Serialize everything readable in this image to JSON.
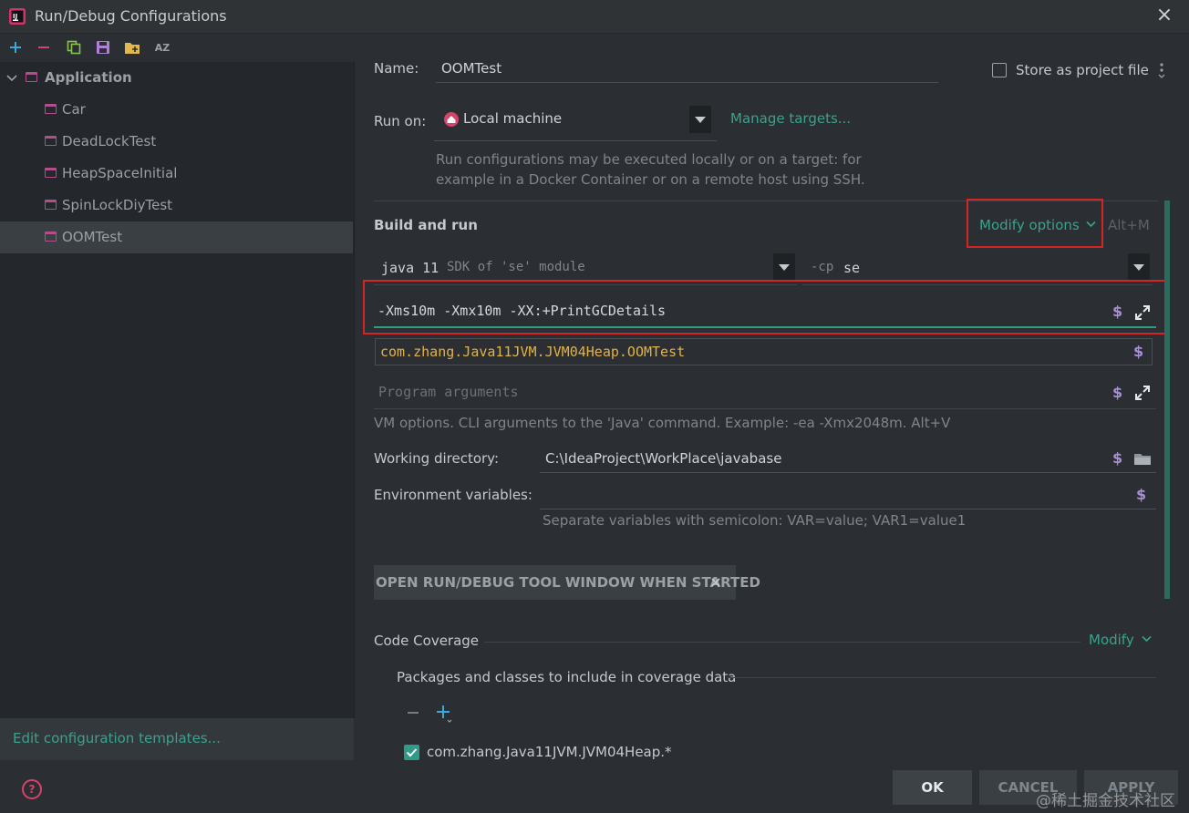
{
  "window": {
    "title": "Run/Debug Configurations",
    "close": "×"
  },
  "toolbar": {
    "sort_label": "AZ"
  },
  "tree": {
    "group": "Application",
    "items": [
      {
        "label": "Car",
        "selected": false
      },
      {
        "label": "DeadLockTest",
        "selected": false
      },
      {
        "label": "HeapSpaceInitial",
        "selected": false
      },
      {
        "label": "SpinLockDiyTest",
        "selected": false
      },
      {
        "label": "OOMTest",
        "selected": true
      }
    ]
  },
  "edit_templates": "Edit configuration templates...",
  "help": "?",
  "form": {
    "name_label": "Name:",
    "name_value": "OOMTest",
    "store_label": "Store as project file",
    "run_on_label": "Run on:",
    "run_on_value": "Local machine",
    "manage_targets": "Manage targets...",
    "run_hint_1": "Run configurations may be executed locally or on a target: for",
    "run_hint_2": "example in a Docker Container or on a remote host using SSH.",
    "build_run": "Build and run",
    "modify_options": "Modify options",
    "modify_shortcut": "Alt+M",
    "jdk_version": "java 11",
    "jdk_desc": "SDK of 'se' module",
    "cp_flag": "-cp",
    "cp_value": "se",
    "vm_options": "-Xms10m -Xmx10m -XX:+PrintGCDetails",
    "main_class": "com.zhang.Java11JVM.JVM04Heap.OOMTest",
    "program_args_placeholder": "Program arguments",
    "vm_hint": "VM options. CLI arguments to the 'Java' command. Example: -ea -Xmx2048m. Alt+V",
    "workdir_label": "Working directory:",
    "workdir_value": "C:\\IdeaProject\\WorkPlace\\javabase",
    "env_label": "Environment variables:",
    "env_hint": "Separate variables with semicolon: VAR=value; VAR1=value1",
    "tag_label": "OPEN RUN/DEBUG TOOL WINDOW WHEN STARTED",
    "code_coverage": "Code Coverage",
    "coverage_modify": "Modify",
    "packages_label": "Packages and classes to include in coverage data",
    "coverage_entry": "com.zhang.Java11JVM.JVM04Heap.*",
    "dollar": "$"
  },
  "buttons": {
    "ok": "OK",
    "cancel": "CANCEL",
    "apply": "APPLY"
  },
  "watermark": "@稀土掘金技术社区",
  "colors": {
    "accent": "#3aa28c",
    "highlight": "#d42525",
    "macro": "#a88ed6",
    "class_name": "#e3b341"
  }
}
